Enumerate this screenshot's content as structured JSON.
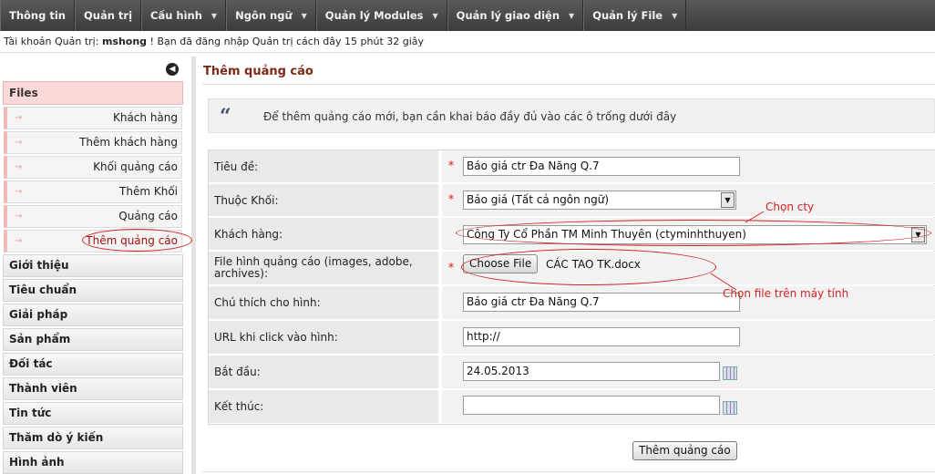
{
  "nav": {
    "items": [
      {
        "label": "Thông tin",
        "dropdown": false
      },
      {
        "label": "Quản trị",
        "dropdown": false
      },
      {
        "label": "Cấu hình",
        "dropdown": true
      },
      {
        "label": "Ngôn ngữ",
        "dropdown": true
      },
      {
        "label": "Quản lý Modules",
        "dropdown": true
      },
      {
        "label": "Quản lý giao diện",
        "dropdown": true
      },
      {
        "label": "Quản lý File",
        "dropdown": true
      }
    ]
  },
  "infobar": {
    "prefix": "Tài khoản Quản trị: ",
    "username": "mshong",
    "suffix": " ! Bạn đã đăng nhập Quản trị cách đây 15 phút 32 giây"
  },
  "sidebar": {
    "section_title": "Files",
    "sub_items": [
      "Khách hàng",
      "Thêm khách hàng",
      "Khối quảng cáo",
      "Thêm Khối",
      "Quảng cáo",
      "Thêm quảng cáo"
    ],
    "active_sub_item": "Thêm quảng cáo",
    "sections": [
      "Giới thiệu",
      "Tiêu chuẩn",
      "Giải pháp",
      "Sản phẩm",
      "Đối tác",
      "Thành viên",
      "Tin tức",
      "Thăm dò ý kiến",
      "Hình ảnh"
    ]
  },
  "main": {
    "title": "Thêm quảng cáo",
    "notice": "Để thêm quảng cáo mới, bạn cần khai báo đầy đủ vào các ô trống dưới đây",
    "form": {
      "title_label": "Tiêu đề:",
      "title_value": "Báo giá ctr Đa Năng Q.7",
      "block_label": "Thuộc Khối:",
      "block_value": "Báo giá (Tất cả ngôn ngữ)",
      "client_label": "Khách hàng:",
      "client_value": "Công Ty Cổ Phần TM Minh Thuyên (ctyminhthuyen)",
      "file_label": "File hình quảng cáo (images, adobe, archives):",
      "file_button": "Choose File",
      "file_name": "CÁC TAO TK.docx",
      "caption_label": "Chú thích cho hình:",
      "caption_value": "Báo giá ctr Đa Năng Q.7",
      "url_label": "URL khi click vào hình:",
      "url_value": "http://",
      "start_label": "Bắt đầu:",
      "start_value": "24.05.2013",
      "end_label": "Kết thúc:",
      "end_value": "",
      "required_mark": "*",
      "submit": "Thêm quảng cáo"
    }
  },
  "annotations": {
    "choose_company": "Chọn cty",
    "choose_file": "Chọn file trên máy tính"
  },
  "colors": {
    "nav_bg": "#444444",
    "accent_title": "#7a2a16",
    "annotation": "#d42020",
    "files_head_bg": "#fbd8d8"
  },
  "icons": {
    "collapse": "circle-arrow-left-icon",
    "quote": "quote-icon",
    "calendar": "calendar-icon",
    "dropdown": "triangle-down-icon"
  }
}
